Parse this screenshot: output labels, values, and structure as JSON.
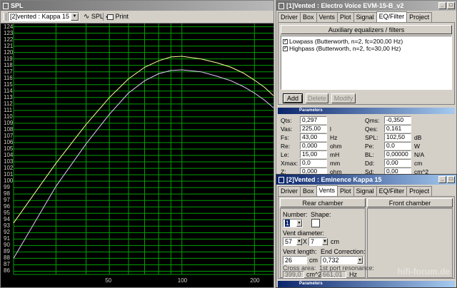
{
  "spl_window": {
    "title": "SPL",
    "toolbar": {
      "dropdown_value": "[2]vented : Kappa 15",
      "spl_button": "SPL",
      "print_button": "Print"
    }
  },
  "chart_data": {
    "type": "line",
    "x_scale": "log",
    "xlim": [
      20,
      240
    ],
    "ylim": [
      85.5,
      124.5
    ],
    "x_tick_labels": [
      "50",
      "100",
      "200"
    ],
    "y_tick_labels": [
      "124",
      "123",
      "122",
      "121",
      "120",
      "119",
      "118",
      "117",
      "116",
      "115",
      "114",
      "113",
      "112",
      "111",
      "110",
      "109",
      "108",
      "107",
      "106",
      "105",
      "104",
      "103",
      "102",
      "101",
      "100",
      "99",
      "98",
      "97",
      "96",
      "95",
      "94",
      "93",
      "92",
      "91",
      "90",
      "89",
      "88",
      "87",
      "86"
    ],
    "grid": true,
    "series": [
      {
        "color": "#ffff99",
        "x": [
          20,
          30,
          40,
          50,
          60,
          70,
          80,
          90,
          100,
          120,
          140,
          160,
          180,
          200,
          220,
          240
        ],
        "y": [
          93.5,
          102.8,
          108.8,
          113.0,
          115.9,
          117.7,
          118.7,
          119.3,
          119.4,
          119.0,
          118.4,
          117.7,
          116.8,
          115.7,
          114.6,
          113.3
        ]
      },
      {
        "color": "#e8c8ff",
        "x": [
          20,
          30,
          40,
          50,
          60,
          70,
          80,
          90,
          100,
          120,
          140,
          160,
          180,
          200,
          220,
          240
        ],
        "y": [
          88.0,
          99.2,
          105.8,
          110.4,
          113.7,
          115.6,
          116.7,
          117.2,
          117.3,
          117.0,
          116.3,
          115.6,
          114.7,
          113.7,
          112.6,
          111.4
        ]
      }
    ]
  },
  "ev_window": {
    "title": "[1]Vented : Electro Voice EVM-15-B_v2",
    "tabs": [
      "Driver",
      "Box",
      "Vents",
      "Plot",
      "Signal",
      "EQ/Filter",
      "Project"
    ],
    "selected_tab": "EQ/Filter",
    "aux_button": "Auxiliary equalizers / filters",
    "filters": [
      "Lowpass (Butterworth, n=2, fc=200,00 Hz)",
      "Highpass (Butterworth, n=2, fc=30,00 Hz)"
    ],
    "add_button": "Add",
    "delete_button": "Delete",
    "modify_button": "Modify",
    "params_header": "Parameters",
    "params_left": [
      {
        "label": "Qts:",
        "value": "0,297",
        "unit": ""
      },
      {
        "label": "Vas:",
        "value": "225,00",
        "unit": "l"
      },
      {
        "label": "Fs:",
        "value": "43,00",
        "unit": "Hz"
      },
      {
        "label": "Re:",
        "value": "0,000",
        "unit": "ohm"
      },
      {
        "label": "Le:",
        "value": "15,00",
        "unit": "mH"
      },
      {
        "label": "Xmax:",
        "value": "0,0",
        "unit": "mm"
      },
      {
        "label": "Z:",
        "value": "0,000",
        "unit": "ohm"
      }
    ],
    "params_right": [
      {
        "label": "Qms:",
        "value": "-0,350",
        "unit": ""
      },
      {
        "label": "Qes:",
        "value": "0,161",
        "unit": ""
      },
      {
        "label": "SPL:",
        "value": "102,50",
        "unit": "dB"
      },
      {
        "label": "Pe:",
        "value": "0,0",
        "unit": "W"
      },
      {
        "label": "BL:",
        "value": "0,00000",
        "unit": "N/A"
      },
      {
        "label": "Dd:",
        "value": "0,00",
        "unit": "cm"
      },
      {
        "label": "Sd:",
        "value": "0,00",
        "unit": "cm^2"
      }
    ]
  },
  "em_window": {
    "title": "[2]Vented : Eminence  Kappa 15",
    "tabs": [
      "Driver",
      "Box",
      "Vents",
      "Plot",
      "Signal",
      "EQ/Filter",
      "Project"
    ],
    "selected_tab": "Vents",
    "rear_chamber_button": "Rear chamber",
    "front_chamber_button": "Front chamber",
    "number_label": "Number:",
    "number_value": "1",
    "shape_label": "Shape:",
    "vent_diameter_label": "Vent diameter:",
    "vent_d1": "57",
    "vent_x": "X",
    "vent_d2": "7",
    "vent_unit": "cm",
    "vent_length_label": "Vent length:",
    "vent_length_value": "26",
    "vent_length_unit": "cm",
    "end_correction_label": "End Correction:",
    "end_correction_value": "0,732",
    "cross_area_label": "Cross area:",
    "cross_area_value": "399,0",
    "cross_area_unit": "cm^2",
    "port_res_label": "1st port resonance:",
    "port_res_value": "661,01",
    "port_res_unit": "Hz",
    "params_header": "Parameters"
  },
  "watermark": "hifi-forum.de",
  "colors": {
    "plot_bg": "#000000",
    "grid": "#00a000",
    "active_title": "#0a246a",
    "inactive_title": "#7a7a7a"
  }
}
